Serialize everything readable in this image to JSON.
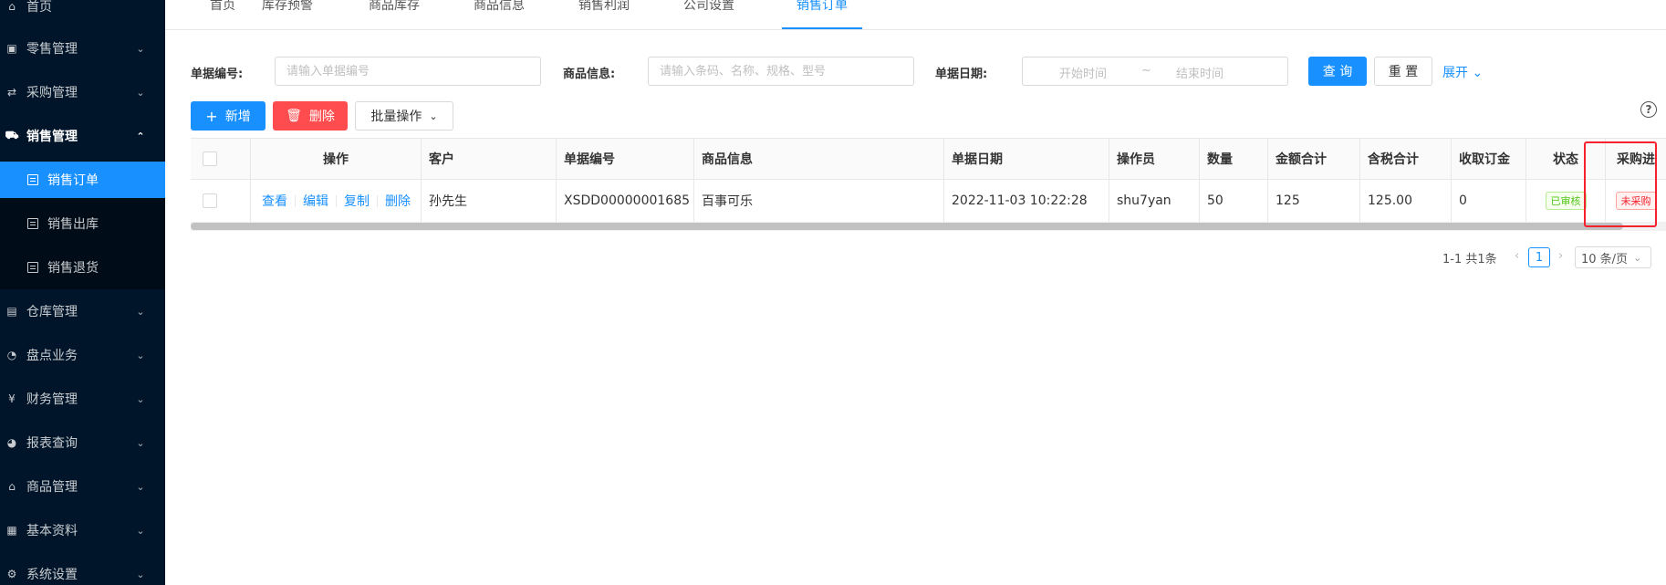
{
  "sidebar": {
    "home": "首页",
    "items": [
      {
        "label": "零售管理",
        "icon": "gift-icon"
      },
      {
        "label": "采购管理",
        "icon": "swap-icon"
      },
      {
        "label": "销售管理",
        "icon": "cart-icon"
      },
      {
        "label": "仓库管理",
        "icon": "warehouse-icon"
      },
      {
        "label": "盘点业务",
        "icon": "dashboard-icon"
      },
      {
        "label": "财务管理",
        "icon": "money-icon"
      },
      {
        "label": "报表查询",
        "icon": "pie-chart-icon"
      },
      {
        "label": "商品管理",
        "icon": "shop-icon"
      },
      {
        "label": "基本资料",
        "icon": "grid-icon"
      },
      {
        "label": "系统设置",
        "icon": "setting-icon"
      }
    ],
    "sub_items": [
      "销售订单",
      "销售出库",
      "销售退货"
    ]
  },
  "tabs": [
    "首页",
    "库存预警",
    "商品库存",
    "商品信息",
    "销售利润",
    "公司设置",
    "销售订单"
  ],
  "filters": {
    "bill_no_label": "单据编号:",
    "bill_no_placeholder": "请输入单据编号",
    "goods_label": "商品信息:",
    "goods_placeholder": "请输入条码、名称、规格、型号",
    "date_label": "单据日期:",
    "date_start": "开始时间",
    "date_sep": "~",
    "date_end": "结束时间",
    "query": "查 询",
    "reset": "重 置",
    "expand": "展开"
  },
  "toolbar": {
    "add": "新增",
    "delete": "删除",
    "batch": "批量操作"
  },
  "table": {
    "headers": [
      "操作",
      "客户",
      "单据编号",
      "商品信息",
      "单据日期",
      "操作员",
      "数量",
      "金额合计",
      "含税合计",
      "收取订金",
      "状态",
      "采购进"
    ],
    "row": {
      "actions": [
        "查看",
        "编辑",
        "复制",
        "删除"
      ],
      "customer": "孙先生",
      "bill_no": "XSDD00000001685",
      "goods": "百事可乐",
      "date": "2022-11-03 10:22:28",
      "operator": "shu7yan",
      "quantity": "50",
      "amount": "125",
      "tax_amount": "125.00",
      "deposit": "0",
      "status": "已审核",
      "purchase_status": "未采购"
    }
  },
  "pagination": {
    "total": "1-1 共1条",
    "page": "1",
    "page_size": "10 条/页"
  },
  "colors": {
    "accent": "#1890ff",
    "sidebar": "#001529",
    "danger": "#ff4d4f"
  }
}
